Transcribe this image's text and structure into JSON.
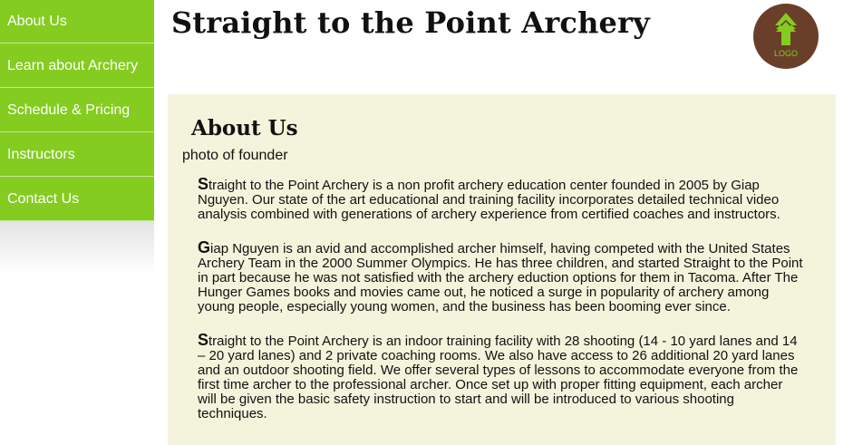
{
  "nav": {
    "items": [
      {
        "label": "About Us"
      },
      {
        "label": "Learn about Archery"
      },
      {
        "label": "Schedule & Pricing"
      },
      {
        "label": "Instructors"
      },
      {
        "label": "Contact Us"
      }
    ]
  },
  "header": {
    "title": "Straight to the Point Archery",
    "logo_text": "LOGO"
  },
  "main": {
    "heading": "About Us",
    "photo_caption": "photo of founder",
    "paragraphs": [
      {
        "first_letter": "S",
        "rest": "traight to the Point Archery is a non profit archery education center founded in 2005 by Giap Nguyen.  Our state of the art educational and training facility incorporates detailed technical video analysis combined with generations of archery experience from certified coaches and instructors."
      },
      {
        "first_letter": "G",
        "rest": "iap Nguyen is an avid and accomplished archer himself, having competed with the United States Archery Team in the 2000 Summer Olympics. He has three children, and started Straight to the Point in part because he was not satisfied with the archery eduction options for them in Tacoma. After The Hunger Games books and movies came out, he noticed a surge in popularity of archery among young people, especially young women, and the business has been booming ever since."
      },
      {
        "first_letter": "S",
        "rest": "traight to the Point Archery is an indoor training facility with  28 shooting (14 -  10 yard lanes and 14 – 20 yard lanes) and 2 private coaching rooms. We also have access to 26  additional 20 yard lanes  and an outdoor shooting field.  We offer several types of lessons to accommodate everyone from the first time archer to the professional archer. Once set up with proper fitting equipment, each archer will be given the basic safety instruction to start and will be introduced to various shooting techniques."
      }
    ]
  },
  "colors": {
    "nav_green": "#84cc20",
    "content_bg": "#f4f4dc",
    "logo_brown": "#6a3f2a"
  },
  "icons": {
    "logo": "arrow-up-logo-icon"
  }
}
